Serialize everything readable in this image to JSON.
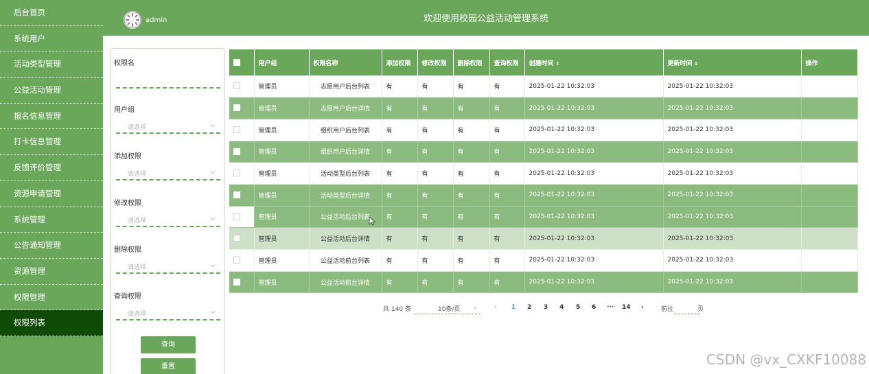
{
  "sidebar": {
    "items": [
      {
        "label": "后台首页"
      },
      {
        "label": "系统用户"
      },
      {
        "label": "活动类型管理"
      },
      {
        "label": "公益活动管理"
      },
      {
        "label": "报名信息管理"
      },
      {
        "label": "打卡信息管理"
      },
      {
        "label": "反馈评价管理"
      },
      {
        "label": "资源申请管理"
      },
      {
        "label": "系统管理"
      },
      {
        "label": "公告通知管理"
      },
      {
        "label": "资源管理"
      },
      {
        "label": "权限管理"
      },
      {
        "label": "权限列表"
      }
    ],
    "active_index": 12
  },
  "header": {
    "user": "admin",
    "title": "欢迎使用校园公益活动管理系统"
  },
  "filter": {
    "perm_name_label": "权限名",
    "perm_name_value": "",
    "user_group_label": "用户组",
    "add_label": "添加权限",
    "edit_label": "修改权限",
    "delete_label": "删除权限",
    "query_label": "查询权限",
    "placeholder": "请选择",
    "search_button": "查询",
    "reset_button": "重置"
  },
  "table": {
    "columns": [
      "用户组",
      "权限名称",
      "添加权限",
      "修改权限",
      "删除权限",
      "查询权限",
      "创建时间",
      "更新时间",
      "操作"
    ],
    "sort_icon": "⇕",
    "rows": [
      {
        "group": "管理员",
        "name": "志愿用户后台列表",
        "add": "有",
        "edit": "有",
        "del": "有",
        "query": "有",
        "created": "2025-01-22 10:32:03",
        "updated": "2025-01-22 10:32:03"
      },
      {
        "group": "管理员",
        "name": "志愿用户后台详情",
        "add": "有",
        "edit": "有",
        "del": "有",
        "query": "有",
        "created": "2025-01-22 10:32:03",
        "updated": "2025-01-22 10:32:03"
      },
      {
        "group": "管理员",
        "name": "组织用户后台列表",
        "add": "有",
        "edit": "有",
        "del": "有",
        "query": "有",
        "created": "2025-01-22 10:32:03",
        "updated": "2025-01-22 10:32:03"
      },
      {
        "group": "管理员",
        "name": "组织用户后台详情",
        "add": "有",
        "edit": "有",
        "del": "有",
        "query": "有",
        "created": "2025-01-22 10:32:03",
        "updated": "2025-01-22 10:32:03"
      },
      {
        "group": "管理员",
        "name": "活动类型后台列表",
        "add": "有",
        "edit": "有",
        "del": "有",
        "query": "有",
        "created": "2025-01-22 10:32:03",
        "updated": "2025-01-22 10:32:03"
      },
      {
        "group": "管理员",
        "name": "活动类型后台详情",
        "add": "有",
        "edit": "有",
        "del": "有",
        "query": "有",
        "created": "2025-01-22 10:32:03",
        "updated": "2025-01-22 10:32:03"
      },
      {
        "group": "管理员",
        "name": "公益活动后台列表",
        "add": "有",
        "edit": "有",
        "del": "有",
        "query": "有",
        "created": "2025-01-22 10:32:03",
        "updated": "2025-01-22 10:32:03"
      },
      {
        "group": "管理员",
        "name": "公益活动后台详情",
        "add": "有",
        "edit": "有",
        "del": "有",
        "query": "有",
        "created": "2025-01-22 10:32:03",
        "updated": "2025-01-22 10:32:03"
      },
      {
        "group": "管理员",
        "name": "公益活动前台列表",
        "add": "有",
        "edit": "有",
        "del": "有",
        "query": "有",
        "created": "2025-01-22 10:32:03",
        "updated": "2025-01-22 10:32:03"
      },
      {
        "group": "管理员",
        "name": "公益活动前台详情",
        "add": "有",
        "edit": "有",
        "del": "有",
        "query": "有",
        "created": "2025-01-22 10:32:03",
        "updated": "2025-01-22 10:32:03"
      }
    ]
  },
  "pagination": {
    "total": "共 140 条",
    "page_size": "10条/页",
    "prev": "‹",
    "pages": [
      "1",
      "2",
      "3",
      "4",
      "5",
      "6"
    ],
    "ellipsis": "···",
    "last": "14",
    "next": "›",
    "jump_prefix": "前往",
    "jump_suffix": "页",
    "current": "1"
  },
  "watermark": "CSDN @vx_CXKF10088",
  "colors": {
    "primary_green": "#6aa75b",
    "active_sidebar": "#0f4a06",
    "stripe_green": "#8bbb7e",
    "hover_row": "#cfe0c9",
    "current_page": "#4a9fe0"
  }
}
